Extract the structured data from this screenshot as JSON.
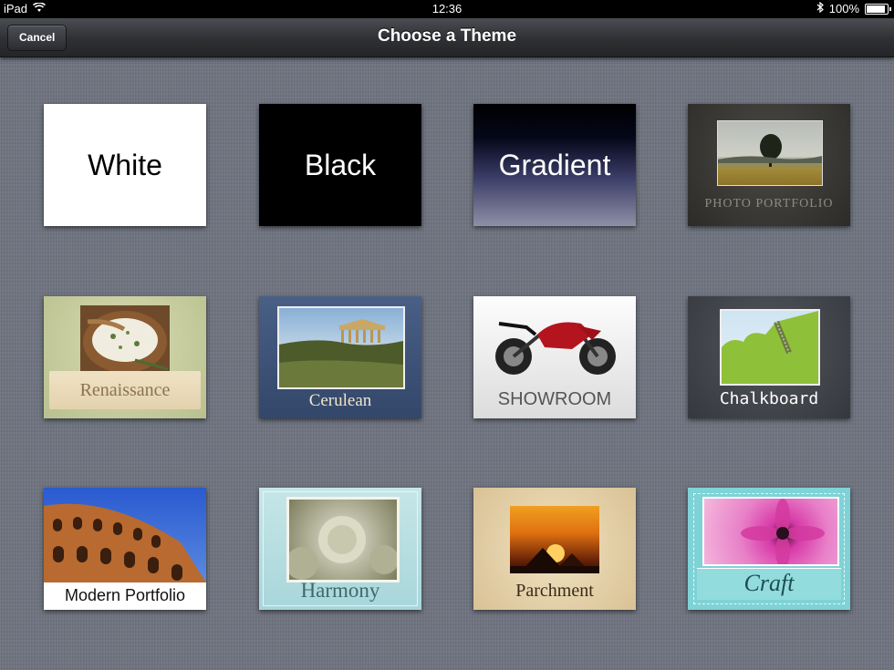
{
  "status_bar": {
    "device": "iPad",
    "time": "12:36",
    "battery": "100%",
    "battery_level": 1.0
  },
  "nav": {
    "title": "Choose a Theme",
    "cancel_label": "Cancel"
  },
  "themes": [
    {
      "label": "White"
    },
    {
      "label": "Black"
    },
    {
      "label": "Gradient"
    },
    {
      "label": "PHOTO PORTFOLIO"
    },
    {
      "label": "Renaissance"
    },
    {
      "label": "Cerulean"
    },
    {
      "label": "SHOWROOM"
    },
    {
      "label": "Chalkboard"
    },
    {
      "label": "Modern Portfolio"
    },
    {
      "label": "Harmony"
    },
    {
      "label": "Parchment"
    },
    {
      "label": "Craft"
    }
  ],
  "colors": {
    "background": "#6f7480",
    "navbar": "#2e3034",
    "cerulean": "#3f5478",
    "craft": "#7fd2d6"
  }
}
